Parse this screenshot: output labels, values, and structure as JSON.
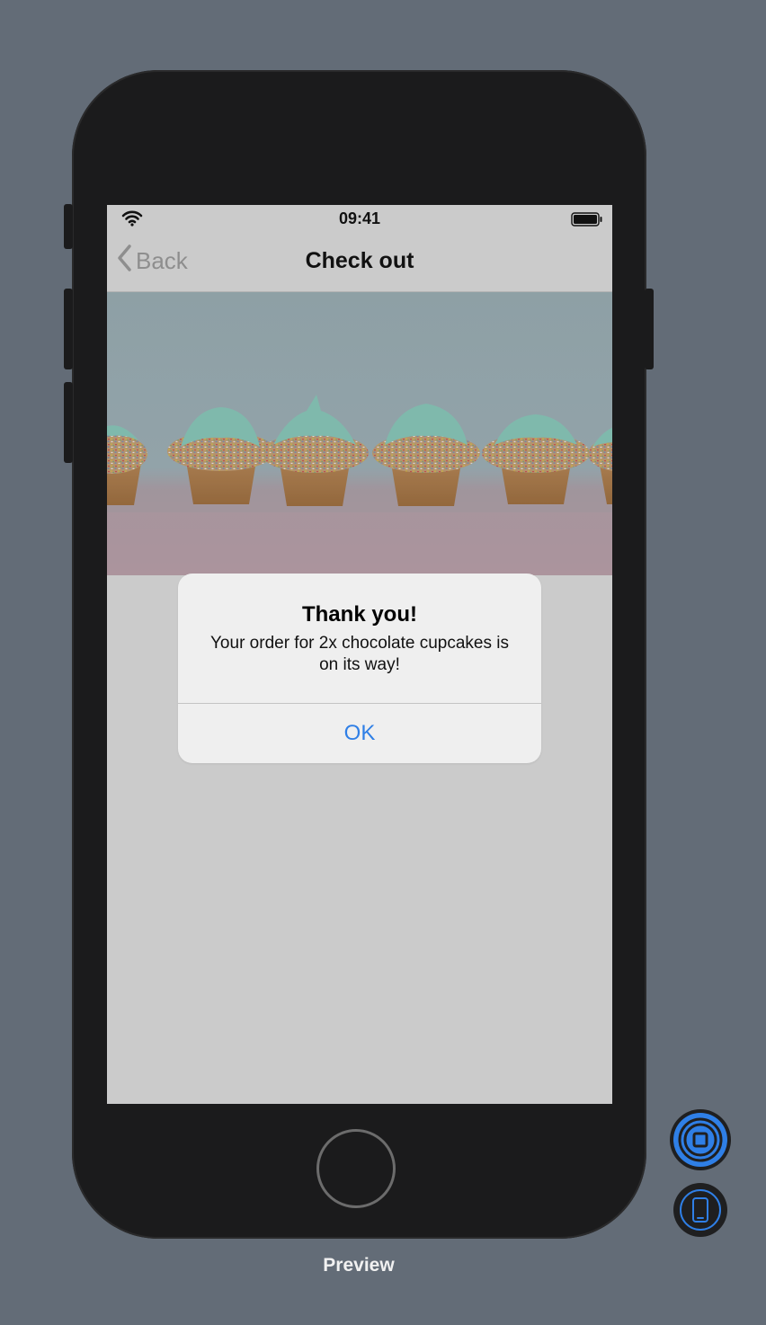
{
  "status_bar": {
    "time": "09:41"
  },
  "nav": {
    "back_label": "Back",
    "title": "Check out"
  },
  "alert": {
    "title": "Thank you!",
    "message": "Your order for 2x chocolate cupcakes is on its way!",
    "ok_label": "OK"
  },
  "preview": {
    "label": "Preview"
  },
  "icons": {
    "wifi": "wifi-icon",
    "battery": "battery-icon",
    "back": "chevron-left-icon",
    "live_preview": "live-preview-icon",
    "device": "device-icon"
  },
  "colors": {
    "accent": "#2f7fe6",
    "background": "#636c77",
    "device_body": "#1b1b1c",
    "screen_dim": "#cbcbcb",
    "frosting": "#8fcfc2"
  }
}
